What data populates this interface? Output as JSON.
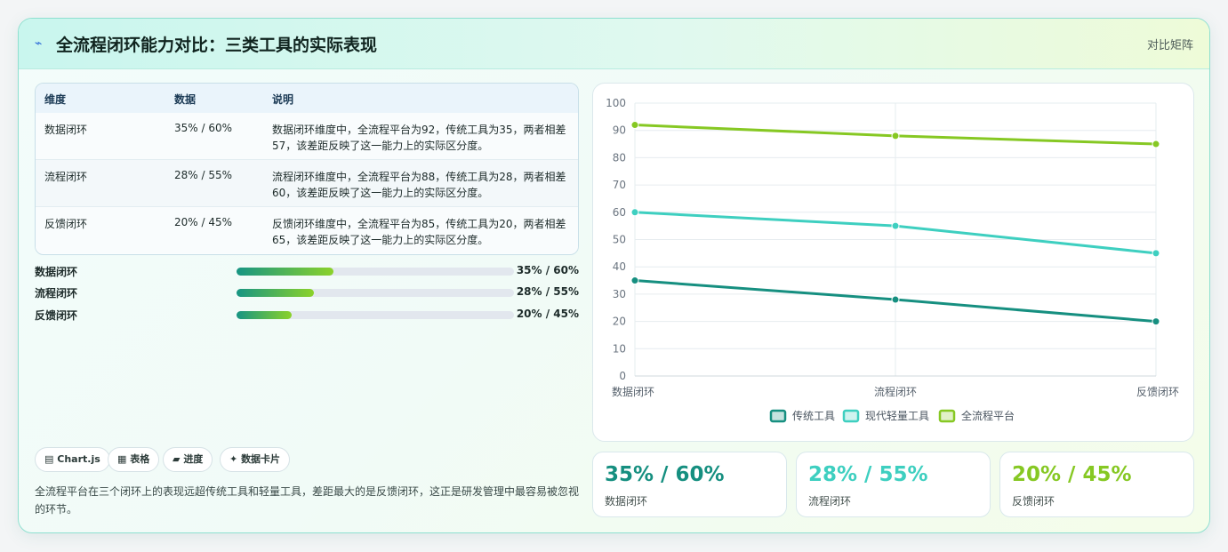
{
  "header": {
    "title": "全流程闭环能力对比：三类工具的实际表现",
    "tag": "对比矩阵"
  },
  "table": {
    "headers": [
      "维度",
      "数据",
      "说明"
    ],
    "rows": [
      {
        "dim": "数据闭环",
        "data": "35% / 60%",
        "desc": "数据闭环维度中，全流程平台为92，传统工具为35，两者相差57，该差距反映了这一能力上的实际区分度。"
      },
      {
        "dim": "流程闭环",
        "data": "28% / 55%",
        "desc": "流程闭环维度中，全流程平台为88，传统工具为28，两者相差60，该差距反映了这一能力上的实际区分度。"
      },
      {
        "dim": "反馈闭环",
        "data": "20% / 45%",
        "desc": "反馈闭环维度中，全流程平台为85，传统工具为20，两者相差65，该差距反映了这一能力上的实际区分度。"
      }
    ]
  },
  "progress": [
    {
      "label": "数据闭环",
      "value": "35% / 60%",
      "fraction": 0.35
    },
    {
      "label": "流程闭环",
      "value": "28% / 55%",
      "fraction": 0.28
    },
    {
      "label": "反馈闭环",
      "value": "20% / 45%",
      "fraction": 0.2
    }
  ],
  "chips": [
    "Chart.js",
    "表格",
    "进度",
    "数据卡片"
  ],
  "chip_icons": [
    "chart-icon",
    "table-icon",
    "progress-icon",
    "card-icon"
  ],
  "summary": "全流程平台在三个闭环上的表现远超传统工具和轻量工具，差距最大的是反馈闭环，这正是研发管理中最容易被忽视的环节。",
  "kpis": [
    {
      "value": "35% / 60%",
      "label": "数据闭环",
      "color": "#168f80"
    },
    {
      "value": "28% / 55%",
      "label": "流程闭环",
      "color": "#3ecfc0"
    },
    {
      "value": "20% / 45%",
      "label": "反馈闭环",
      "color": "#86c823"
    }
  ],
  "chart_data": {
    "type": "line",
    "categories": [
      "数据闭环",
      "流程闭环",
      "反馈闭环"
    ],
    "series": [
      {
        "name": "传统工具",
        "values": [
          35,
          28,
          20
        ],
        "color": "#168f80"
      },
      {
        "name": "现代轻量工具",
        "values": [
          60,
          55,
          45
        ],
        "color": "#3ecfc0"
      },
      {
        "name": "全流程平台",
        "values": [
          92,
          88,
          85
        ],
        "color": "#86c823"
      }
    ],
    "ylim": [
      0,
      100
    ],
    "yticks": [
      0,
      10,
      20,
      30,
      40,
      50,
      60,
      70,
      80,
      90,
      100
    ],
    "grid": true,
    "legend": "bottom"
  }
}
